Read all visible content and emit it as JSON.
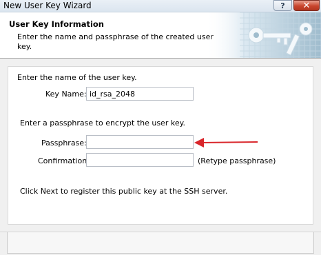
{
  "window": {
    "title": "New User Key Wizard",
    "help_glyph": "?",
    "close_glyph": "✕"
  },
  "header": {
    "title": "User Key Information",
    "description": "Enter the name and passphrase of the created user key.",
    "art_icon": "keys-icon"
  },
  "form": {
    "name_instruction": "Enter the name of the user key.",
    "key_name_label": "Key Name:",
    "key_name_value": "id_rsa_2048",
    "passphrase_instruction": "Enter a passphrase to encrypt the user key.",
    "passphrase_label": "Passphrase:",
    "passphrase_value": "",
    "confirmation_label": "Confirmation:",
    "confirmation_value": "",
    "retype_hint": "(Retype passphrase)",
    "next_instruction": "Click Next to register this public key at the SSH server."
  },
  "annotation": {
    "arrow_color": "#d9262b"
  }
}
